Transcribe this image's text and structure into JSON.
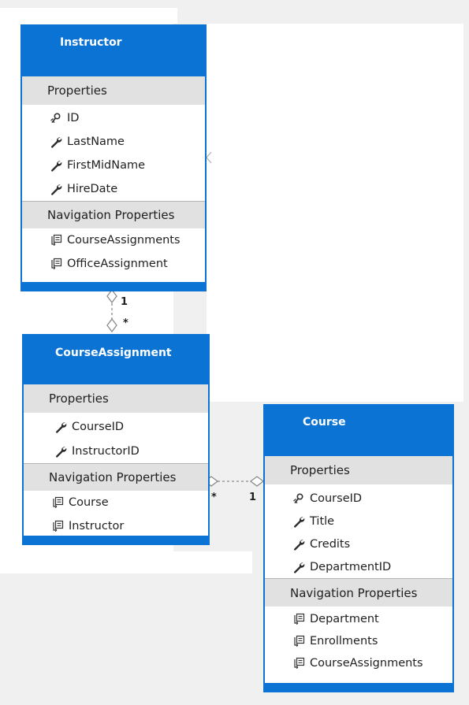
{
  "entities": {
    "instructor": {
      "title": "Instructor",
      "properties_label": "Properties",
      "properties": [
        "ID",
        "LastName",
        "FirstMidName",
        "HireDate"
      ],
      "property_icons": [
        "key-icon",
        "wrench-icon",
        "wrench-icon",
        "wrench-icon"
      ],
      "navigation_label": "Navigation Properties",
      "navigation": [
        "CourseAssignments",
        "OfficeAssignment"
      ]
    },
    "course_assignment": {
      "title": "CourseAssignment",
      "properties_label": "Properties",
      "properties": [
        "CourseID",
        "InstructorID"
      ],
      "property_icons": [
        "wrench-icon",
        "wrench-icon"
      ],
      "navigation_label": "Navigation Properties",
      "navigation": [
        "Course",
        "Instructor"
      ]
    },
    "course": {
      "title": "Course",
      "properties_label": "Properties",
      "properties": [
        "CourseID",
        "Title",
        "Credits",
        "DepartmentID"
      ],
      "property_icons": [
        "key-icon",
        "wrench-icon",
        "wrench-icon",
        "wrench-icon"
      ],
      "navigation_label": "Navigation Properties",
      "navigation": [
        "Department",
        "Enrollments",
        "CourseAssignments"
      ]
    }
  },
  "associations": {
    "instructor_courseassignment": {
      "one_end": "1",
      "many_end": "*"
    },
    "courseassignment_course": {
      "many_end": "*",
      "one_end": "1"
    }
  },
  "colors": {
    "entity_header": "#0b73d4",
    "section_header": "#e1e1e1",
    "text": "#1f1f1f",
    "background": "#f0f0f0"
  }
}
